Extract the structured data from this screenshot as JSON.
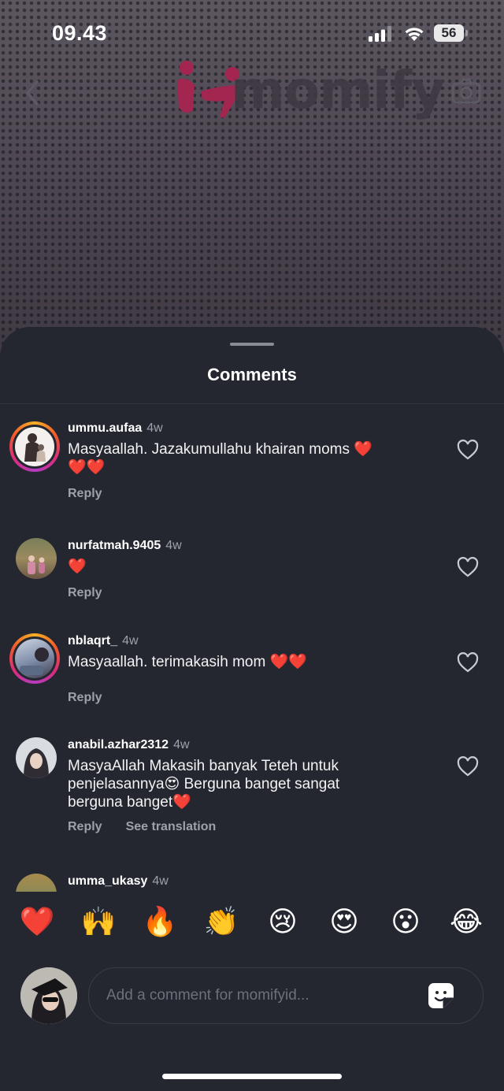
{
  "status": {
    "time": "09.43",
    "battery": "56"
  },
  "header": {
    "logo_text": "momify"
  },
  "sheet": {
    "title": "Comments"
  },
  "comments": [
    {
      "username": "ummu.aufaa",
      "ago": "4w",
      "text": "Masyaallah. Jazakumullahu khairan moms",
      "hearts_inline": "❤️",
      "hearts_line2": "❤️❤️",
      "reply": "Reply"
    },
    {
      "username": "nurfatmah.9405",
      "ago": "4w",
      "text": "❤️",
      "reply": "Reply"
    },
    {
      "username": "nblaqrt_",
      "ago": "4w",
      "text": "Masyaallah. terimakasih mom ❤️❤️",
      "reply": "Reply"
    },
    {
      "username": "anabil.azhar2312",
      "ago": "4w",
      "text": "MasyaAllah Makasih banyak Teteh untuk penjelasannya😍 Berguna banget sangat berguna banget❤️",
      "reply": "Reply",
      "translate": "See translation"
    },
    {
      "username": "umma_ukasy",
      "ago": "4w"
    }
  ],
  "quick_reactions": [
    "❤️",
    "🙌",
    "🔥",
    "👏",
    "😢",
    "😍",
    "😮",
    "😂"
  ],
  "composer": {
    "placeholder": "Add a comment for momifyid..."
  },
  "icons": {
    "back": "chevron-left-icon",
    "camera": "camera-icon",
    "like": "heart-outline-icon",
    "sticker": "sticker-icon"
  },
  "colors": {
    "sheet": "#252730",
    "heart": "#ff2d3d",
    "muted": "#9ea1aa"
  }
}
